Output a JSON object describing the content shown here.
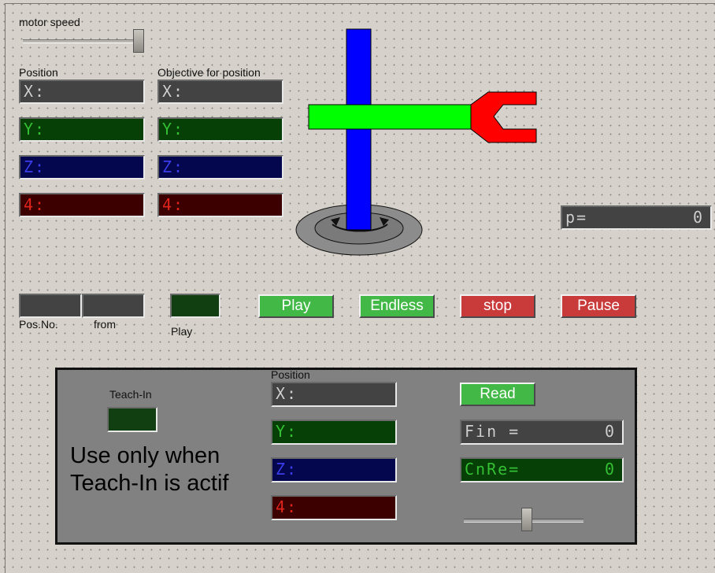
{
  "motor": {
    "label": "motor speed",
    "speed_fraction": 0.95
  },
  "position": {
    "title": "Position",
    "x": "X:",
    "y": "Y:",
    "z": "Z:",
    "a4": "4:"
  },
  "objective": {
    "title": "Objective for position",
    "x": "X:",
    "y": "Y:",
    "z": "Z:",
    "a4": "4:"
  },
  "p_display": {
    "prefix": "p=",
    "value": "0"
  },
  "playback": {
    "pos_no_label": "Pos.No.",
    "from_label": "from",
    "play_indicator_label": "Play",
    "play_button": "Play",
    "endless_button": "Endless",
    "stop_button": "stop",
    "pause_button": "Pause"
  },
  "teach": {
    "label": "Teach-In",
    "note_line1": "Use only when",
    "note_line2": "Teach-In is actif",
    "position_title": "Position",
    "x": "X:",
    "y": "Y:",
    "z": "Z:",
    "a4": "4:",
    "read_button": "Read",
    "fin_prefix": "Fin =",
    "fin_value": "0",
    "cnre_prefix": "CnRe=",
    "cnre_value": "0",
    "slider_fraction": 0.55
  },
  "colors": {
    "button_green": "#42b946",
    "button_red": "#c93a3a",
    "robot_column": "#0000ff",
    "robot_arm": "#00ff00",
    "robot_gripper": "#ff0000"
  }
}
